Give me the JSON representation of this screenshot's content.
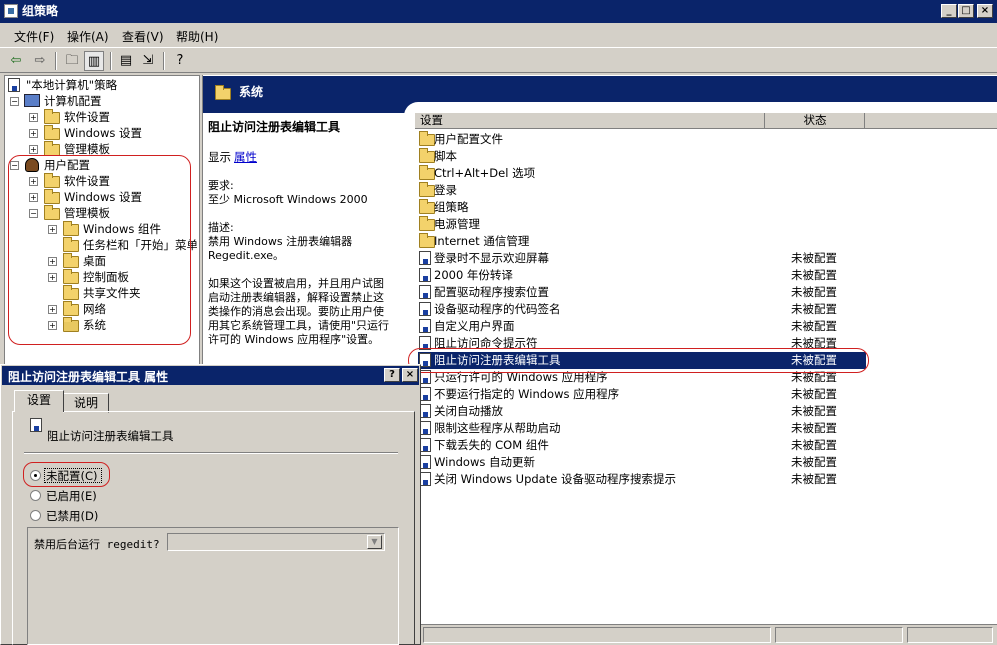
{
  "window": {
    "title": "组策略",
    "min": "_",
    "max": "□",
    "close": "×"
  },
  "menu": [
    "文件(F)",
    "操作(A)",
    "查看(V)",
    "帮助(H)"
  ],
  "toolbar_icons": [
    "back-icon",
    "forward-icon",
    "up-folder-icon",
    "show-hide-tree-icon",
    "properties-icon",
    "export-list-icon",
    "help-icon"
  ],
  "tree": {
    "root": "\"本地计算机\"策略",
    "computer": "计算机配置",
    "computer_children": [
      "软件设置",
      "Windows 设置",
      "管理模板"
    ],
    "user": "用户配置",
    "user_children": [
      "软件设置",
      "Windows 设置",
      "管理模板"
    ],
    "templates": [
      "Windows 组件",
      "任务栏和「开始」菜单",
      "桌面",
      "控制面板",
      "共享文件夹",
      "网络",
      "系统"
    ]
  },
  "section_header": "系统",
  "description": {
    "title": "阻止访问注册表编辑工具",
    "show_label": "显示",
    "properties_link": "属性",
    "requirements_label": "要求:",
    "requirements_value": "至少 Microsoft Windows 2000",
    "desc_label": "描述:",
    "desc_line1": "禁用 Windows 注册表编辑器",
    "desc_line2": "Regedit.exe。",
    "body_line1": "如果这个设置被启用，并且用户试图",
    "body_line2": "启动注册表编辑器，解释设置禁止这",
    "body_line3": "类操作的消息会出现。要防止用户使",
    "body_line4": "用其它系统管理工具，请使用\"只运行",
    "body_line5": "许可的 Windows 应用程序\"设置。"
  },
  "list": {
    "col_setting": "设置",
    "col_status": "状态",
    "folders": [
      "用户配置文件",
      "脚本",
      "Ctrl+Alt+Del 选项",
      "登录",
      "组策略",
      "电源管理",
      "Internet 通信管理"
    ],
    "policies": [
      {
        "name": "登录时不显示欢迎屏幕",
        "status": "未被配置"
      },
      {
        "name": "2000 年份转译",
        "status": "未被配置"
      },
      {
        "name": "配置驱动程序搜索位置",
        "status": "未被配置"
      },
      {
        "name": "设备驱动程序的代码签名",
        "status": "未被配置"
      },
      {
        "name": "自定义用户界面",
        "status": "未被配置"
      },
      {
        "name": "阻止访问命令提示符",
        "status": "未被配置"
      },
      {
        "name": "阻止访问注册表编辑工具",
        "status": "未被配置"
      },
      {
        "name": "只运行许可的 Windows 应用程序",
        "status": "未被配置"
      },
      {
        "name": "不要运行指定的 Windows 应用程序",
        "status": "未被配置"
      },
      {
        "name": "关闭自动播放",
        "status": "未被配置"
      },
      {
        "name": "限制这些程序从帮助启动",
        "status": "未被配置"
      },
      {
        "name": "下载丢失的 COM 组件",
        "status": "未被配置"
      },
      {
        "name": "Windows 自动更新",
        "status": "未被配置"
      },
      {
        "name": "关闭 Windows Update 设备驱动程序搜索提示",
        "status": "未被配置"
      }
    ]
  },
  "dialog": {
    "title": "阻止访问注册表编辑工具 属性",
    "help_btn": "?",
    "close_btn": "×",
    "tab_settings": "设置",
    "tab_explain": "说明",
    "policy_name": "阻止访问注册表编辑工具",
    "opt_not_configured": "未配置(C)",
    "opt_enabled": "已启用(E)",
    "opt_disabled": "已禁用(D)",
    "option_label": "禁用后台运行 regedit?"
  }
}
